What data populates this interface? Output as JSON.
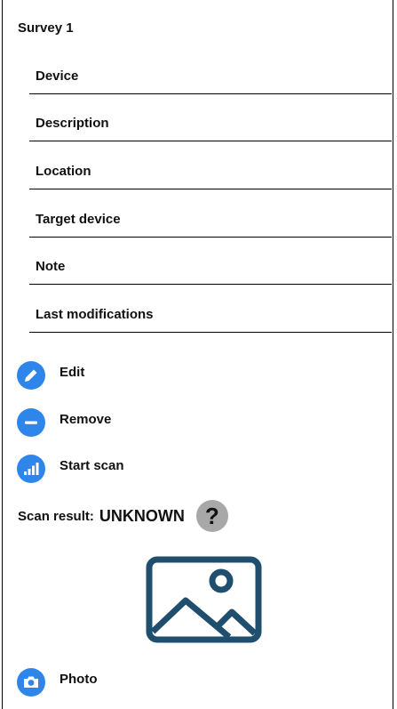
{
  "survey": {
    "title": "Survey 1"
  },
  "fields": [
    {
      "label": "Device"
    },
    {
      "label": "Description"
    },
    {
      "label": "Location"
    },
    {
      "label": "Target device"
    },
    {
      "label": "Note"
    },
    {
      "label": "Last modifications"
    }
  ],
  "actions": {
    "edit": {
      "label": "Edit",
      "icon": "pencil-icon"
    },
    "remove": {
      "label": "Remove",
      "icon": "minus-icon"
    },
    "start_scan": {
      "label": "Start scan",
      "icon": "signal-bars-icon"
    },
    "photo": {
      "label": "Photo",
      "icon": "camera-icon"
    }
  },
  "scan_result": {
    "label": "Scan result:",
    "value": "UNKNOWN",
    "help_icon": "help-icon"
  },
  "image": {
    "icon": "image-placeholder-icon"
  },
  "colors": {
    "accent": "#2f86ea",
    "help_bg": "#a8a8a8",
    "image_icon": "#1f4e6e"
  }
}
